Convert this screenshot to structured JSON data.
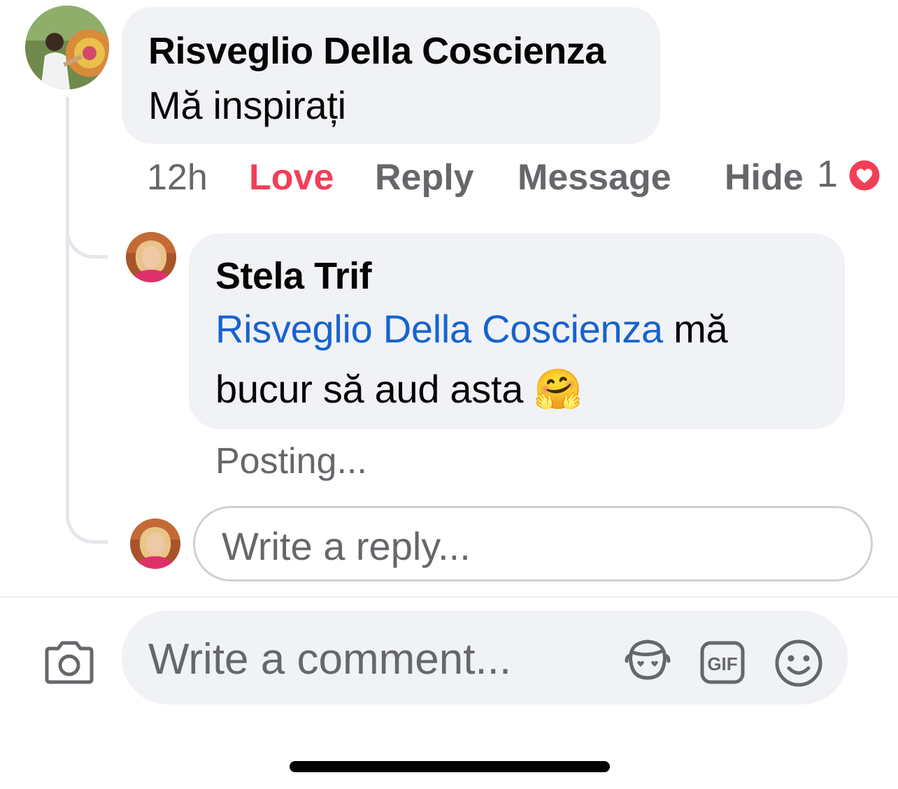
{
  "comment": {
    "author": "Risveglio Della Coscienza",
    "text": "Mă inspirați",
    "time": "12h",
    "actions": {
      "love": "Love",
      "reply": "Reply",
      "message": "Message",
      "hide": "Hide"
    },
    "reaction_count": "1",
    "reaction_icon": "heart-icon",
    "colors": {
      "love": "#f33e58",
      "heart": "#f33e58"
    }
  },
  "reply": {
    "author": "Stela Trif",
    "mention": "Risveglio Della Coscienza",
    "text_line1_rest": " mă",
    "text_line2": "bucur să aud asta ",
    "emoji": "🤗",
    "status": "Posting...",
    "colors": {
      "mention": "#1763cf"
    }
  },
  "reply_input": {
    "placeholder": "Write a reply..."
  },
  "composer": {
    "placeholder": "Write a comment...",
    "icons": [
      "camera-icon",
      "avatar-sticker-icon",
      "gif-icon",
      "emoji-icon"
    ],
    "gif_label": "GIF"
  }
}
